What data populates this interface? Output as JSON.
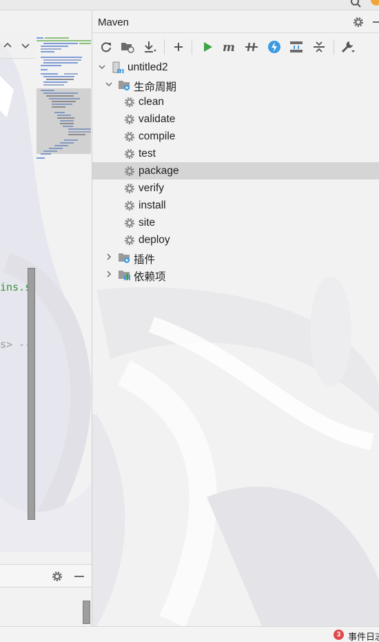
{
  "maven_panel": {
    "title": "Maven",
    "toolbar": [
      {
        "icon": "reload-icon"
      },
      {
        "icon": "generate-sources-icon"
      },
      {
        "icon": "download-icon"
      },
      {
        "icon": "add-icon"
      },
      {
        "icon": "run-icon"
      },
      {
        "icon": "maven-goal-icon"
      },
      {
        "icon": "toggle-offline-icon"
      },
      {
        "icon": "skip-tests-icon"
      },
      {
        "icon": "show-dependencies-icon"
      },
      {
        "icon": "collapse-all-icon"
      },
      {
        "icon": "settings-wrench-icon"
      }
    ],
    "tree": {
      "project": "untitled2",
      "lifecycle": {
        "label": "生命周期",
        "goals": [
          "clean",
          "validate",
          "compile",
          "test",
          "package",
          "verify",
          "install",
          "site",
          "deploy"
        ],
        "selected": "package"
      },
      "plugins": "插件",
      "dependencies": "依赖项"
    }
  },
  "editor": {
    "code_fragment_1": "ins.s",
    "code_fragment_2": "s> --"
  },
  "status_bar": {
    "event_count": "3",
    "event_label": "事件日志"
  },
  "colors": {
    "accent_blue": "#3c9be0",
    "run_green": "#3ea448",
    "selection": "#d5d5d5",
    "badge_red": "#e0474b"
  }
}
